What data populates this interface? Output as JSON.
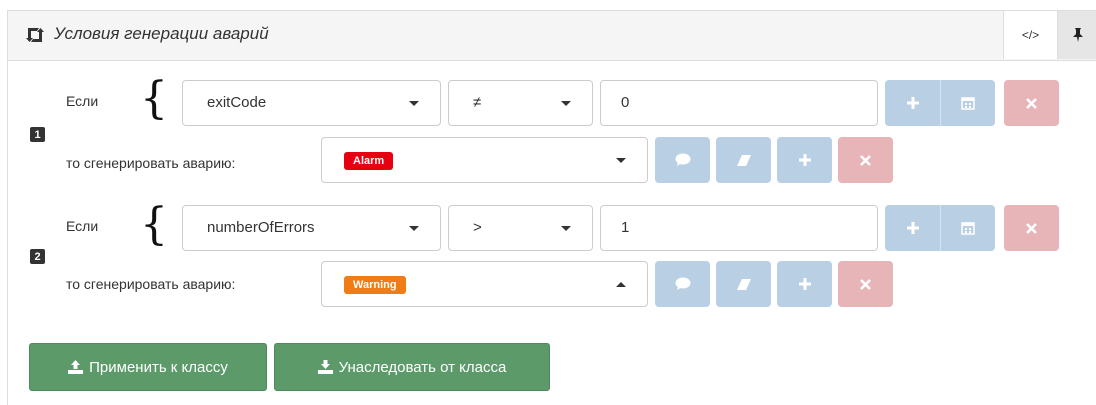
{
  "panel": {
    "title": "Условия генерации аварий",
    "code_button": "</>"
  },
  "labels": {
    "if": "Если",
    "then": "то сгенерировать аварию:"
  },
  "rules": [
    {
      "number": "1",
      "field": "exitCode",
      "operator": "≠",
      "value": "0",
      "alarm": {
        "label": "Alarm",
        "color": "#e60012"
      },
      "select_open": false
    },
    {
      "number": "2",
      "field": "numberOfErrors",
      "operator": ">",
      "value": "1",
      "alarm": {
        "label": "Warning",
        "color": "#f07c15"
      },
      "select_open": true
    }
  ],
  "footer": {
    "apply_label": "Применить к классу",
    "inherit_label": "Унаследовать от класса"
  },
  "colors": {
    "blue_button": "#b9cfe3",
    "red_button": "#e7b4b8",
    "green_button": "#5c9a6a"
  },
  "icons": [
    "retweet-icon",
    "code-icon",
    "pin-icon",
    "plus-icon",
    "calendar-icon",
    "times-icon",
    "comment-icon",
    "eraser-icon",
    "upload-icon",
    "download-icon"
  ]
}
